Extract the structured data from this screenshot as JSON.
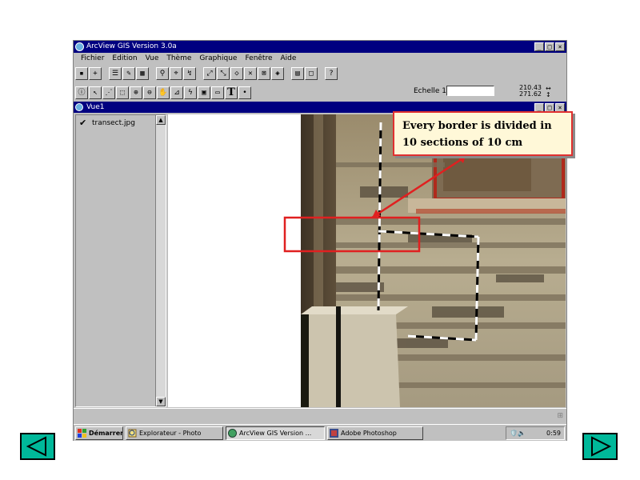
{
  "app": {
    "title": "ArcView GIS Version 3.0a",
    "window_buttons": [
      "_",
      "□",
      "×"
    ],
    "menu": [
      "Fichier",
      "Edition",
      "Vue",
      "Thème",
      "Graphique",
      "Fenêtre",
      "Aide"
    ],
    "scale_label": "Echelle 1:",
    "scale_value": "",
    "coord_x": "210.43",
    "coord_y": "271.62"
  },
  "view": {
    "title": "Vue1",
    "layer_name": "transect.jpg",
    "layer_checked": true
  },
  "taskbar": {
    "items": [
      {
        "label": "Démarrer",
        "icon": "windows-flag-icon"
      },
      {
        "label": "Explorateur - Photo",
        "icon": "explorer-icon"
      },
      {
        "label": "ArcView GIS Version ...",
        "icon": "arcview-globe-icon"
      },
      {
        "label": "Adobe Photoshop",
        "icon": "photoshop-icon"
      }
    ],
    "clock": "0:59"
  },
  "callout": {
    "line1": "Every border is divided in",
    "line2": "10 sections of 10 cm"
  },
  "colors": {
    "title_bar": "#000080",
    "window_face": "#c0c0c0",
    "callout_border": "#e03030",
    "callout_fill": "#fff8d8",
    "nav_button": "#00b89a"
  }
}
